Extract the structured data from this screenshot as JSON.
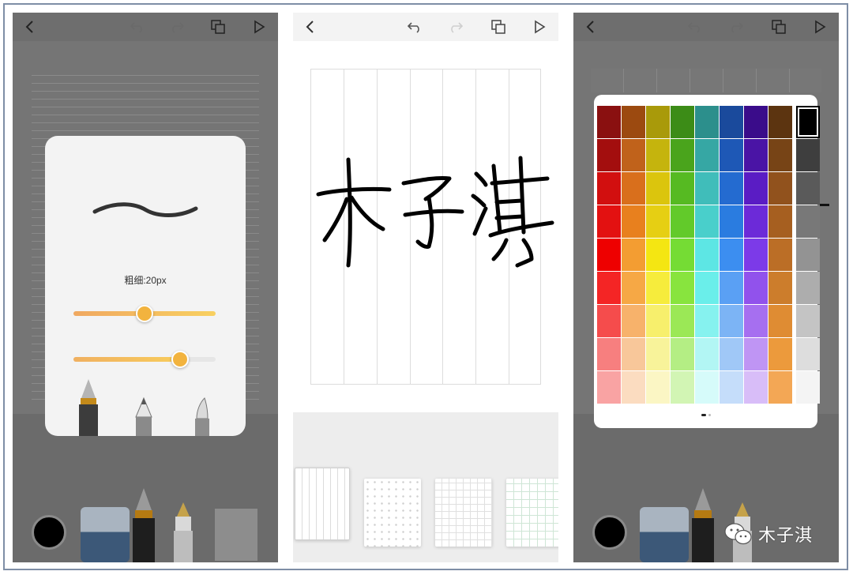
{
  "panel_left": {
    "toolbar": {
      "back_icon": "chevron-left-icon",
      "undo_icon": "undo-icon",
      "redo_icon": "redo-icon",
      "layers_icon": "layers-icon",
      "play_icon": "play-icon"
    },
    "brush_popup": {
      "thickness_label": "粗细:20px",
      "thickness_slider_level": 0.5,
      "opacity_slider_level": 0.75,
      "tools": [
        "fountain-pen-icon",
        "pencil-icon",
        "brush-pen-icon"
      ]
    },
    "bottom_tools": [
      "color-circle-icon",
      "eraser-icon",
      "fountain-pen-icon",
      "marker-icon",
      "paper-icon"
    ],
    "current_color": "#000000"
  },
  "panel_middle": {
    "toolbar": {
      "back_icon": "chevron-left-icon",
      "undo_icon": "undo-icon",
      "redo_icon": "redo-icon",
      "layers_icon": "layers-icon",
      "play_icon": "play-icon"
    },
    "handwriting": "木子淇",
    "paper_templates": [
      "vertical-lines",
      "dot-grid",
      "square-grid",
      "green-grid"
    ]
  },
  "panel_right": {
    "toolbar": {
      "back_icon": "chevron-left-icon",
      "undo_icon": "undo-icon",
      "redo_icon": "redo-icon",
      "layers_icon": "layers-icon",
      "play_icon": "play-icon"
    },
    "palette_columns": [
      [
        "#8a1010",
        "#a30e0e",
        "#d20f0f",
        "#e31111",
        "#ee0000",
        "#f42525",
        "#f54c4c",
        "#f77f7f",
        "#f9a3a3"
      ],
      [
        "#9c4a10",
        "#c0621b",
        "#d96f1c",
        "#e8801e",
        "#f39d32",
        "#f6a845",
        "#f7b26b",
        "#f8c79a",
        "#fbdcc0"
      ],
      [
        "#a99a0a",
        "#c5b40d",
        "#dbc50d",
        "#e6cf13",
        "#f4e612",
        "#f6ec3c",
        "#f7ef6c",
        "#f8f39a",
        "#fbf6c4"
      ],
      [
        "#3c8c17",
        "#4aa41c",
        "#56ba22",
        "#62ca2a",
        "#75dc34",
        "#88e43e",
        "#9be856",
        "#b4ee84",
        "#d2f5b4"
      ],
      [
        "#2c8f8c",
        "#36a7a4",
        "#40bdba",
        "#49cfcb",
        "#5de6e4",
        "#6aeeea",
        "#86f2ef",
        "#b2f6f4",
        "#d6fbfa"
      ],
      [
        "#1a4a9c",
        "#1e58b6",
        "#246bd0",
        "#2a7ce0",
        "#3c8ef0",
        "#5aa0f4",
        "#7cb4f5",
        "#a0c8f7",
        "#c5ddfa"
      ],
      [
        "#3a0c8a",
        "#4a14a5",
        "#5a1cc4",
        "#6c2ad8",
        "#7c3ae8",
        "#9152ec",
        "#a66ff0",
        "#bf95f4",
        "#d8bdf8"
      ],
      [
        "#5c3410",
        "#774416",
        "#91521d",
        "#a65f20",
        "#bb6e26",
        "#cc7d2c",
        "#df8c33",
        "#ec9a3c",
        "#f3a755"
      ],
      [
        "#000000",
        "#3e3e3e",
        "#5a5a5a",
        "#787878",
        "#939393",
        "#adadad",
        "#c4c4c4",
        "#dddddd",
        "#f4f4f4"
      ]
    ]
  },
  "watermark": {
    "icon": "wechat-icon",
    "text": "木子淇"
  }
}
